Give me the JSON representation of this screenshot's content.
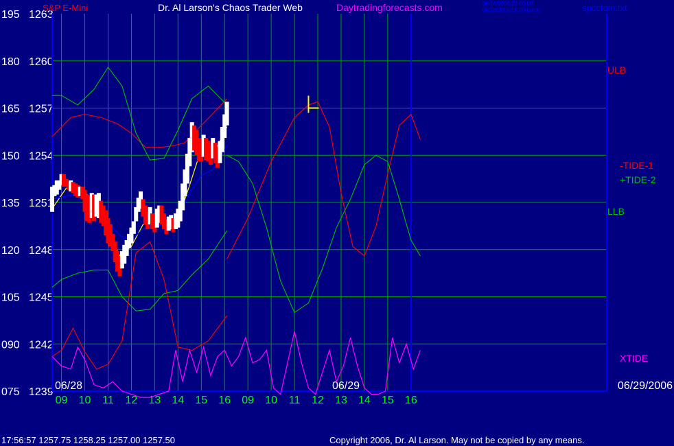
{
  "header": {
    "instrument": "S&P E-Mini",
    "title": "Dr. Al Larson's Chaos Trader Web",
    "site": "Daytradingforecasts.com",
    "stamp_ut": "06/28/2006 22:00 UT",
    "stamp_local": "06/28/2006 18:00 Local",
    "file": "spcctom.txt"
  },
  "footer": {
    "quote": "17:56:57   1257.75  1258.25  1257.00  1257.50",
    "copyright": "Copyright 2006, Dr. Al Larson. May not be copied by any means."
  },
  "colors": {
    "background": "#000080",
    "grid": "#00a000",
    "axis_label": "#ffffff",
    "time_label": "#00ff00",
    "price": "#ffffff",
    "price_down": "#ff0000",
    "ma_fast": "#ffff00",
    "ma_slow": "#0000ff",
    "red_line": "#ff0000",
    "green_line": "#00c000",
    "xtide": "#ff00ff",
    "date_label": "#ffffff",
    "divider": "#0000ff",
    "marker": "#ffff00"
  },
  "legend": {
    "ulb": "ULB",
    "tide1": "-TIDE-1",
    "tide2": "+TIDE-2",
    "llb": "LLB",
    "xtide": "XTIDE"
  },
  "chart_data": {
    "type": "line",
    "y_left_labels": [
      "195",
      "180",
      "165",
      "150",
      "135",
      "120",
      "105",
      "090",
      "075"
    ],
    "y_price_labels": [
      "1263",
      "1260",
      "1257",
      "1254",
      "1251",
      "1248",
      "1245",
      "1242",
      "1239"
    ],
    "ylim_price": [
      1239,
      1263
    ],
    "ylim_left": [
      75,
      195
    ],
    "x_ticks": [
      "09",
      "10",
      "11",
      "12",
      "13",
      "14",
      "15",
      "16",
      "09",
      "10",
      "11",
      "12",
      "13",
      "14",
      "15",
      "16"
    ],
    "date_labels": [
      "06/28",
      "06/29",
      "06/29/2006"
    ],
    "xlim": [
      8.6,
      32.4
    ],
    "divider_x": 24.0,
    "price_end_x": 24.0,
    "marker": {
      "x": 19.6,
      "price": 1257.0
    },
    "price_bars": [
      [
        8.6,
        1250.4,
        1252.0
      ],
      [
        8.7,
        1251.4,
        1252.1
      ],
      [
        8.8,
        1251.5,
        1252.4
      ],
      [
        8.9,
        1251.8,
        1252.4
      ],
      [
        9.0,
        1252.1,
        1252.8
      ],
      [
        9.1,
        1252.0,
        1252.8
      ],
      [
        9.2,
        1252.0,
        1252.5
      ],
      [
        9.3,
        1251.8,
        1252.3
      ],
      [
        9.4,
        1251.7,
        1252.4
      ],
      [
        9.5,
        1251.6,
        1252.3
      ],
      [
        9.6,
        1251.4,
        1252.2
      ],
      [
        9.7,
        1251.3,
        1252.1
      ],
      [
        9.8,
        1251.4,
        1252.0
      ],
      [
        9.9,
        1251.2,
        1252.0
      ],
      [
        10.0,
        1250.4,
        1251.8
      ],
      [
        10.1,
        1249.8,
        1251.5
      ],
      [
        10.2,
        1249.7,
        1251.4
      ],
      [
        10.3,
        1250.0,
        1251.6
      ],
      [
        10.4,
        1249.8,
        1251.5
      ],
      [
        10.5,
        1250.1,
        1251.5
      ],
      [
        10.6,
        1250.0,
        1251.6
      ],
      [
        10.7,
        1249.7,
        1251.1
      ],
      [
        10.8,
        1249.5,
        1250.8
      ],
      [
        10.9,
        1248.9,
        1250.5
      ],
      [
        11.0,
        1248.4,
        1250.0
      ],
      [
        11.1,
        1248.2,
        1249.6
      ],
      [
        11.2,
        1247.9,
        1249.0
      ],
      [
        11.3,
        1247.2,
        1248.5
      ],
      [
        11.4,
        1246.6,
        1247.9
      ],
      [
        11.5,
        1246.3,
        1247.6
      ],
      [
        11.6,
        1246.8,
        1247.9
      ],
      [
        11.7,
        1247.1,
        1248.3
      ],
      [
        11.8,
        1247.6,
        1248.6
      ],
      [
        11.9,
        1248.1,
        1249.0
      ],
      [
        12.0,
        1248.4,
        1249.4
      ],
      [
        12.1,
        1249.0,
        1249.8
      ],
      [
        12.2,
        1249.8,
        1250.7
      ],
      [
        12.3,
        1250.4,
        1251.3
      ],
      [
        12.4,
        1250.6,
        1251.7
      ],
      [
        12.5,
        1250.1,
        1251.2
      ],
      [
        12.6,
        1249.6,
        1250.8
      ],
      [
        12.7,
        1249.3,
        1250.4
      ],
      [
        12.8,
        1249.6,
        1250.7
      ],
      [
        12.9,
        1249.3,
        1250.3
      ],
      [
        13.0,
        1249.1,
        1250.2
      ],
      [
        13.1,
        1249.4,
        1250.6
      ],
      [
        13.2,
        1249.7,
        1250.8
      ],
      [
        13.3,
        1249.6,
        1250.8
      ],
      [
        13.4,
        1249.3,
        1250.3
      ],
      [
        13.5,
        1249.0,
        1249.9
      ],
      [
        13.6,
        1249.2,
        1250.1
      ],
      [
        13.7,
        1249.3,
        1250.2
      ],
      [
        13.8,
        1249.1,
        1250.0
      ],
      [
        13.9,
        1249.3,
        1250.3
      ],
      [
        14.0,
        1249.4,
        1250.6
      ],
      [
        14.1,
        1249.8,
        1251.1
      ],
      [
        14.2,
        1250.5,
        1252.2
      ],
      [
        14.3,
        1251.4,
        1253.1
      ],
      [
        14.4,
        1252.2,
        1254.1
      ],
      [
        14.5,
        1253.3,
        1255.1
      ],
      [
        14.6,
        1254.2,
        1256.1
      ],
      [
        14.7,
        1254.3,
        1255.9
      ],
      [
        14.8,
        1254.0,
        1255.6
      ],
      [
        14.9,
        1253.6,
        1255.1
      ],
      [
        15.0,
        1253.6,
        1255.0
      ],
      [
        15.1,
        1253.9,
        1255.3
      ],
      [
        15.2,
        1253.7,
        1255.1
      ],
      [
        15.3,
        1253.6,
        1254.9
      ],
      [
        15.4,
        1253.4,
        1254.6
      ],
      [
        15.5,
        1253.8,
        1255.1
      ],
      [
        15.6,
        1253.5,
        1254.8
      ],
      [
        15.7,
        1253.2,
        1254.5
      ],
      [
        15.8,
        1253.5,
        1254.9
      ],
      [
        15.9,
        1254.2,
        1255.8
      ],
      [
        16.0,
        1255.1,
        1256.6
      ],
      [
        16.1,
        1255.9,
        1257.4
      ]
    ],
    "series": [
      {
        "name": "ULB",
        "role": "red_line",
        "x": [
          8.6,
          9.4,
          10.0,
          10.7,
          11.4,
          12.0,
          12.6,
          13.2,
          13.8,
          14.3,
          14.8,
          15.4,
          16.1
        ],
        "y": [
          1255.2,
          1256.4,
          1256.6,
          1256.4,
          1256.0,
          1255.4,
          1254.5,
          1254.5,
          1254.6,
          1254.8,
          1255.6,
          1256.5,
          1257.6
        ]
      },
      {
        "name": "",
        "role": "red_line",
        "x": [
          16.1,
          17.0,
          18.0,
          19.0,
          19.6,
          20.0,
          20.5,
          21.0,
          21.5,
          22.0,
          22.5,
          23.0,
          23.5,
          24.0,
          24.4
        ],
        "y": [
          1247.4,
          1250.0,
          1253.6,
          1256.4,
          1257.2,
          1257.4,
          1255.8,
          1251.6,
          1248.2,
          1247.6,
          1249.5,
          1252.8,
          1255.9,
          1256.6,
          1255.0
        ]
      },
      {
        "name": "",
        "role": "green_line",
        "x": [
          8.6,
          9.0,
          9.7,
          10.4,
          11.0,
          11.6,
          12.2,
          12.8,
          13.4,
          14.0,
          14.6,
          15.3,
          16.1
        ],
        "y": [
          1257.8,
          1257.8,
          1257.2,
          1258.2,
          1259.6,
          1258.4,
          1255.4,
          1253.7,
          1253.8,
          1255.6,
          1257.6,
          1258.4,
          1257.2
        ]
      },
      {
        "name": "",
        "role": "green_line",
        "x": [
          16.1,
          16.6,
          17.2,
          17.8,
          18.4,
          19.0,
          19.6,
          20.2,
          20.8,
          21.4,
          22.0,
          22.5,
          23.0,
          23.4,
          24.0,
          24.4
        ],
        "y": [
          1254.0,
          1253.6,
          1252.2,
          1249.4,
          1246.0,
          1244.0,
          1244.6,
          1246.8,
          1249.4,
          1251.2,
          1253.4,
          1254.0,
          1253.6,
          1251.7,
          1248.6,
          1247.6
        ]
      },
      {
        "name": "",
        "role": "green_line",
        "x": [
          8.6,
          9.0,
          9.7,
          10.4,
          11.0,
          11.6,
          12.2,
          12.8,
          13.4,
          14.0,
          14.6,
          15.3,
          16.1
        ],
        "y": [
          1245.6,
          1246.1,
          1246.5,
          1246.7,
          1246.7,
          1245.0,
          1244.1,
          1244.2,
          1245.2,
          1245.4,
          1246.4,
          1247.4,
          1249.2
        ]
      },
      {
        "name": "",
        "role": "red_line",
        "x": [
          8.6,
          9.0,
          9.5,
          10.0,
          10.5,
          11.0,
          11.6,
          12.2,
          12.8,
          13.4,
          14.0,
          14.6,
          15.3,
          16.1
        ],
        "y": [
          1241.2,
          1241.6,
          1243.0,
          1241.5,
          1240.4,
          1240.7,
          1242.2,
          1247.8,
          1248.5,
          1246.1,
          1241.8,
          1241.6,
          1242.2,
          1243.8
        ]
      },
      {
        "name": "",
        "role": "ma_fast",
        "x": [
          8.6,
          9.2,
          9.8,
          10.4,
          11.0,
          11.5,
          12.0,
          12.5,
          13.0,
          13.5,
          14.0,
          14.5,
          15.0,
          15.5,
          16.1
        ],
        "y": [
          1250.6,
          1251.9,
          1252.0,
          1251.0,
          1249.1,
          1247.6,
          1248.2,
          1249.6,
          1249.8,
          1249.8,
          1249.9,
          1252.1,
          1254.4,
          1254.0,
          1255.8
        ]
      },
      {
        "name": "",
        "role": "ma_slow",
        "x": [
          8.6,
          9.2,
          9.8,
          10.4,
          11.0,
          11.5,
          12.0,
          12.5,
          13.0,
          13.5,
          14.0,
          14.5,
          15.0,
          15.5,
          16.1
        ],
        "y": [
          1251.2,
          1251.4,
          1251.6,
          1251.2,
          1249.7,
          1248.9,
          1248.6,
          1249.3,
          1249.5,
          1249.6,
          1250.0,
          1251.6,
          1252.7,
          1253.1,
          1254.6
        ]
      }
    ],
    "xtide": {
      "x": [
        8.6,
        9.0,
        9.4,
        9.7,
        10.0,
        10.4,
        10.8,
        11.2,
        11.6,
        12.0,
        12.4,
        12.8,
        13.2,
        13.6,
        13.9,
        14.2,
        14.5,
        14.8,
        15.1,
        15.4,
        15.7,
        16.0,
        16.3,
        16.6,
        16.9,
        17.2,
        17.5,
        17.8,
        18.1,
        18.4,
        18.7,
        19.0,
        19.3,
        19.6,
        19.9,
        20.2,
        20.5,
        20.8,
        21.1,
        21.4,
        21.7,
        22.0,
        22.3,
        22.6,
        22.9,
        23.2,
        23.5,
        23.8,
        24.1,
        24.4
      ],
      "y": [
        86,
        83,
        82,
        89,
        85,
        77,
        76,
        78,
        75,
        74,
        73,
        73,
        74,
        75,
        88,
        78,
        88,
        81,
        89,
        80,
        86,
        88,
        83,
        86,
        92,
        84,
        85,
        88,
        76,
        74,
        84,
        94,
        84,
        76,
        74,
        81,
        88,
        78,
        83,
        92,
        83,
        76,
        74,
        74,
        75,
        92,
        84,
        90,
        82,
        88
      ]
    }
  }
}
